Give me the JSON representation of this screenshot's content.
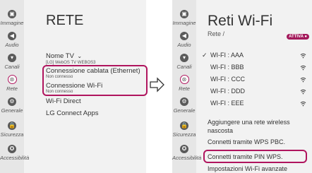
{
  "sidebar": [
    {
      "label": "Immagine",
      "icon": "picture-icon",
      "glyph": "▣"
    },
    {
      "label": "Audio",
      "icon": "speaker-icon",
      "glyph": "◀"
    },
    {
      "label": "Canali",
      "icon": "channels-icon",
      "glyph": "▾"
    },
    {
      "label": "Rete",
      "icon": "network-icon",
      "glyph": "⊛"
    },
    {
      "label": "Generale",
      "icon": "general-settings-icon",
      "glyph": "⚙"
    },
    {
      "label": "Sicurezza",
      "icon": "lock-icon",
      "glyph": "🔒"
    },
    {
      "label": "Accessibilità",
      "icon": "accessibility-icon",
      "glyph": "✪"
    }
  ],
  "rete_panel": {
    "title": "RETE",
    "tv_name_label": "Nome TV",
    "tv_name_value": "[LG] WebOS TV WEBOS3",
    "wired_label": "Connessione cablata (Ethernet)",
    "wired_status": "Non connesso",
    "wifi_label": "Connessione Wi-Fi",
    "wifi_status": "Non connesso",
    "wifi_direct": "Wi-Fi Direct",
    "lg_connect": "LG Connect Apps"
  },
  "wifi_panel": {
    "title": "Reti Wi-Fi",
    "breadcrumb": "Rete /",
    "badge": "ATTIVA",
    "networks": [
      {
        "name": "WI-FI : AAA",
        "checked": true
      },
      {
        "name": "WI-FI : BBB",
        "checked": false
      },
      {
        "name": "WI-FI : CCC",
        "checked": false
      },
      {
        "name": "WI-FI : DDD",
        "checked": false
      },
      {
        "name": "WI-FI : EEE",
        "checked": false
      }
    ],
    "add_hidden": "Aggiungere una rete wireless nascosta",
    "wps_pbc": "Connetti tramite WPS PBC.",
    "wps_pin": "Connetti tramite PIN WPS.",
    "advanced": "Impostazioni Wi-Fi avanzate"
  },
  "colors": {
    "accent": "#b0155e"
  }
}
